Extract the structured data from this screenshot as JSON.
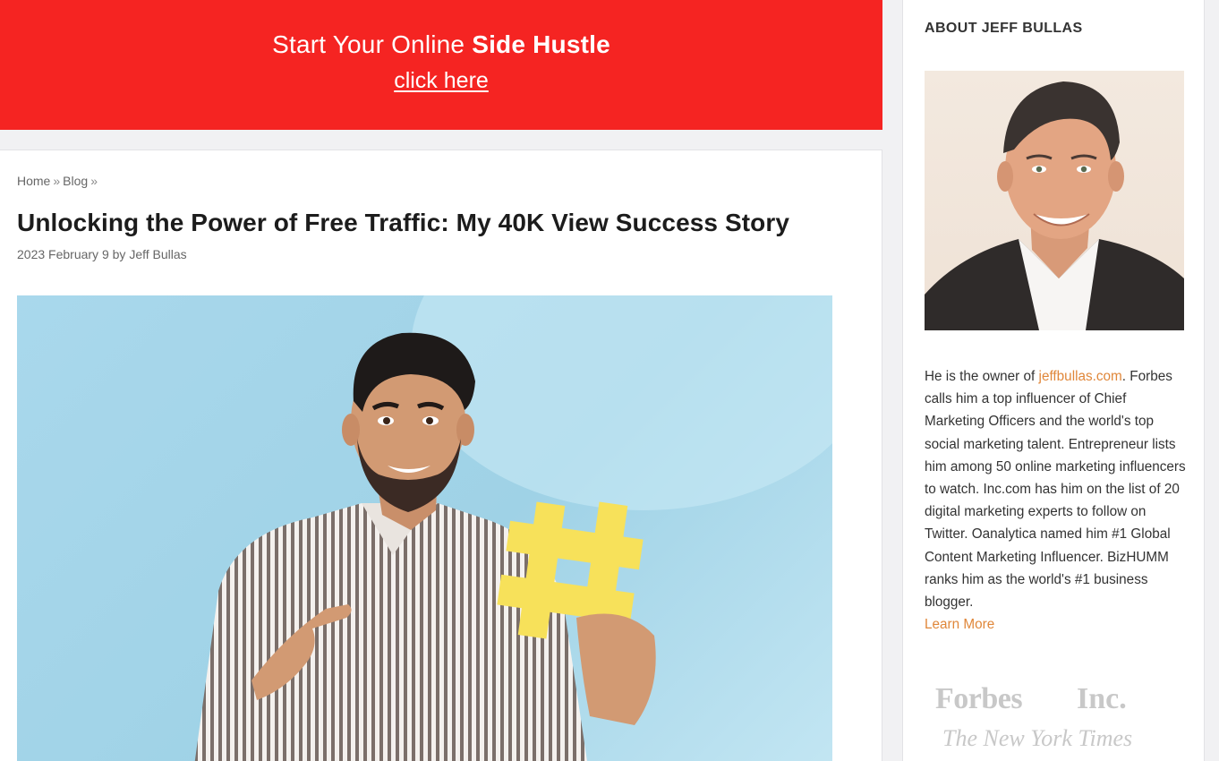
{
  "promo": {
    "line_prefix": "Start Your Online ",
    "line_bold": "Side Hustle",
    "link": "click here"
  },
  "breadcrumb": {
    "home": "Home",
    "sep": "»",
    "blog": "Blog"
  },
  "article": {
    "title": "Unlocking the Power of Free Traffic: My 40K View Success Story",
    "date": "2023 February 9",
    "by": "by",
    "author": "Jeff Bullas"
  },
  "sidebar": {
    "title": "ABOUT JEFF BULLAS",
    "bio_start": "He is the owner of ",
    "bio_link": "jeffbullas.com",
    "bio_rest": ". Forbes calls him a top influencer of Chief Marketing Officers and the world's top social marketing talent. Entrepreneur lists him among 50 online marketing influencers to watch. Inc.com has him on the list of 20 digital marketing experts to follow on Twitter. Oanalytica named him #1 Global Content Marketing Influencer. BizHUMM ranks him as the world's #1 business blogger.",
    "learn_more": "Learn More",
    "logos": {
      "forbes": "Forbes",
      "inc": "Inc.",
      "nyt": "The New York Times"
    }
  },
  "colors": {
    "promo_bg": "#f52422",
    "link_accent": "#e0873a",
    "hero_bg": "#a9d8ec",
    "hashtag_yellow": "#f7e15a"
  }
}
